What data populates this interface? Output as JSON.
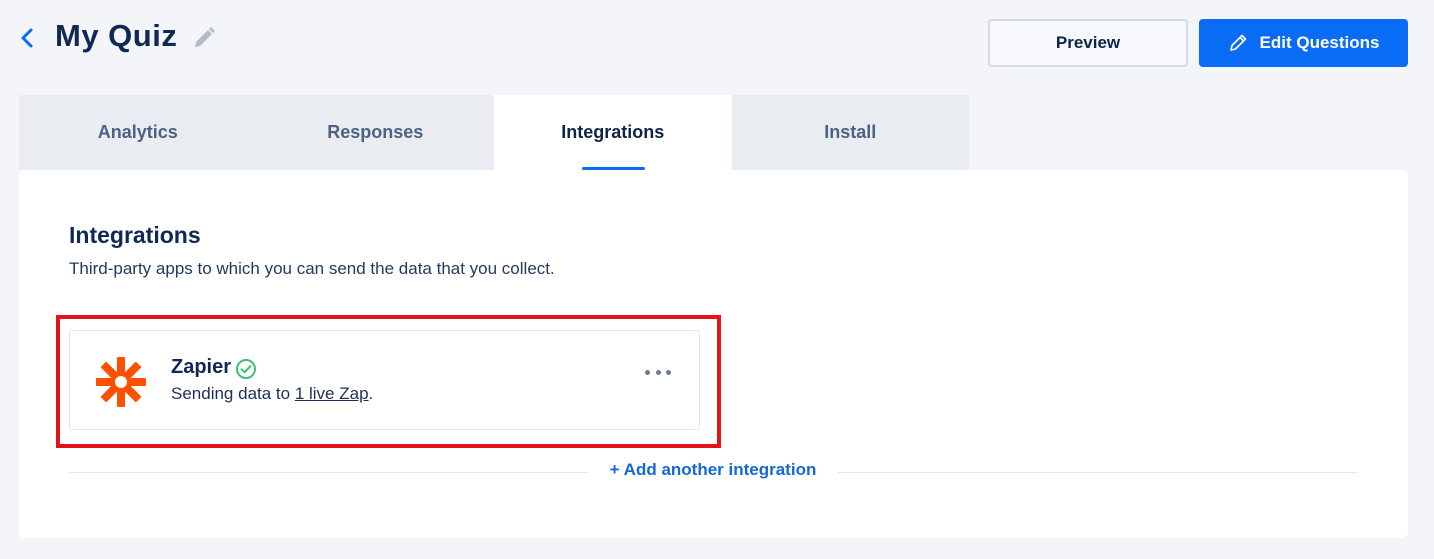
{
  "header": {
    "title": "My Quiz",
    "preview_label": "Preview",
    "edit_label": "Edit Questions"
  },
  "tabs": [
    {
      "label": "Analytics",
      "active": false
    },
    {
      "label": "Responses",
      "active": false
    },
    {
      "label": "Integrations",
      "active": true
    },
    {
      "label": "Install",
      "active": false
    }
  ],
  "integrations": {
    "title": "Integrations",
    "description": "Third-party apps to which you can send the data that you collect.",
    "items": [
      {
        "name": "Zapier",
        "status_prefix": "Sending data to ",
        "status_link": "1 live Zap",
        "status_suffix": ".",
        "connected": true,
        "icon": "zapier-logo-icon"
      }
    ],
    "add_label": "+ Add another integration"
  },
  "colors": {
    "accent": "#0a6cf4",
    "zapier": "#ff4f00",
    "success": "#3cc07a",
    "highlight": "#e5121a"
  }
}
